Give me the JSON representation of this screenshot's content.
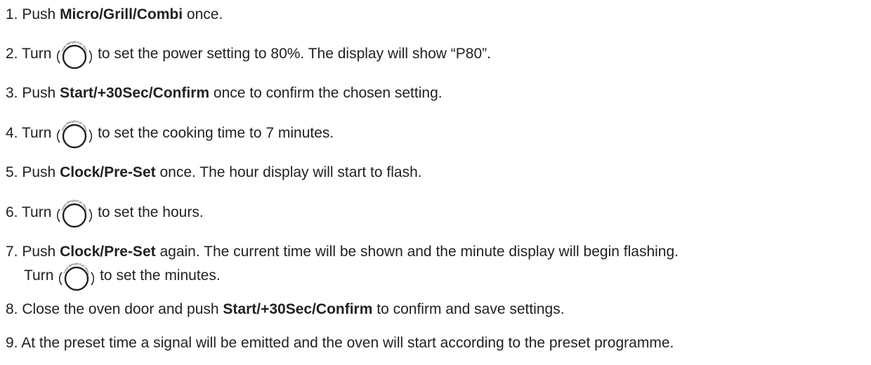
{
  "steps": [
    {
      "num": "1.",
      "parts": [
        "Push ",
        "Micro/Grill/Combi",
        " once."
      ],
      "bold": [
        1
      ]
    },
    {
      "num": "2.",
      "before": "Turn",
      "after": "to set the power setting to 80%. The display will show “P80”.",
      "icon": "dial-knob-icon"
    },
    {
      "num": "3.",
      "parts": [
        "Push ",
        "Start/+30Sec/Confirm",
        " once to confirm the chosen setting."
      ],
      "bold": [
        1
      ]
    },
    {
      "num": "4.",
      "before": "Turn",
      "after": "to set the cooking time to 7 minutes.",
      "icon": "dial-knob-icon"
    },
    {
      "num": "5.",
      "parts": [
        "Push ",
        "Clock/Pre-Set",
        " once. The hour display will start to flash."
      ],
      "bold": [
        1
      ]
    },
    {
      "num": "6.",
      "before": "Turn",
      "after": "to set the hours.",
      "icon": "dial-knob-icon"
    },
    {
      "num": "7.",
      "parts": [
        "Push ",
        "Clock/Pre-Set",
        " again. The current time will be shown and the minute display will begin flashing."
      ],
      "bold": [
        1
      ]
    },
    {
      "num": "",
      "before": "Turn",
      "after": "to set the minutes.",
      "icon": "dial-knob-icon"
    },
    {
      "num": "8.",
      "parts": [
        "Close the oven door and push ",
        "Start/+30Sec/Confirm",
        " to confirm and save settings."
      ],
      "bold": [
        1
      ]
    },
    {
      "num": "9.",
      "parts": [
        "At the preset time a signal will be emitted and the oven will start according to the preset programme."
      ],
      "bold": []
    }
  ],
  "dial_ring_labels": "Timer•Weight•Auto Menu"
}
